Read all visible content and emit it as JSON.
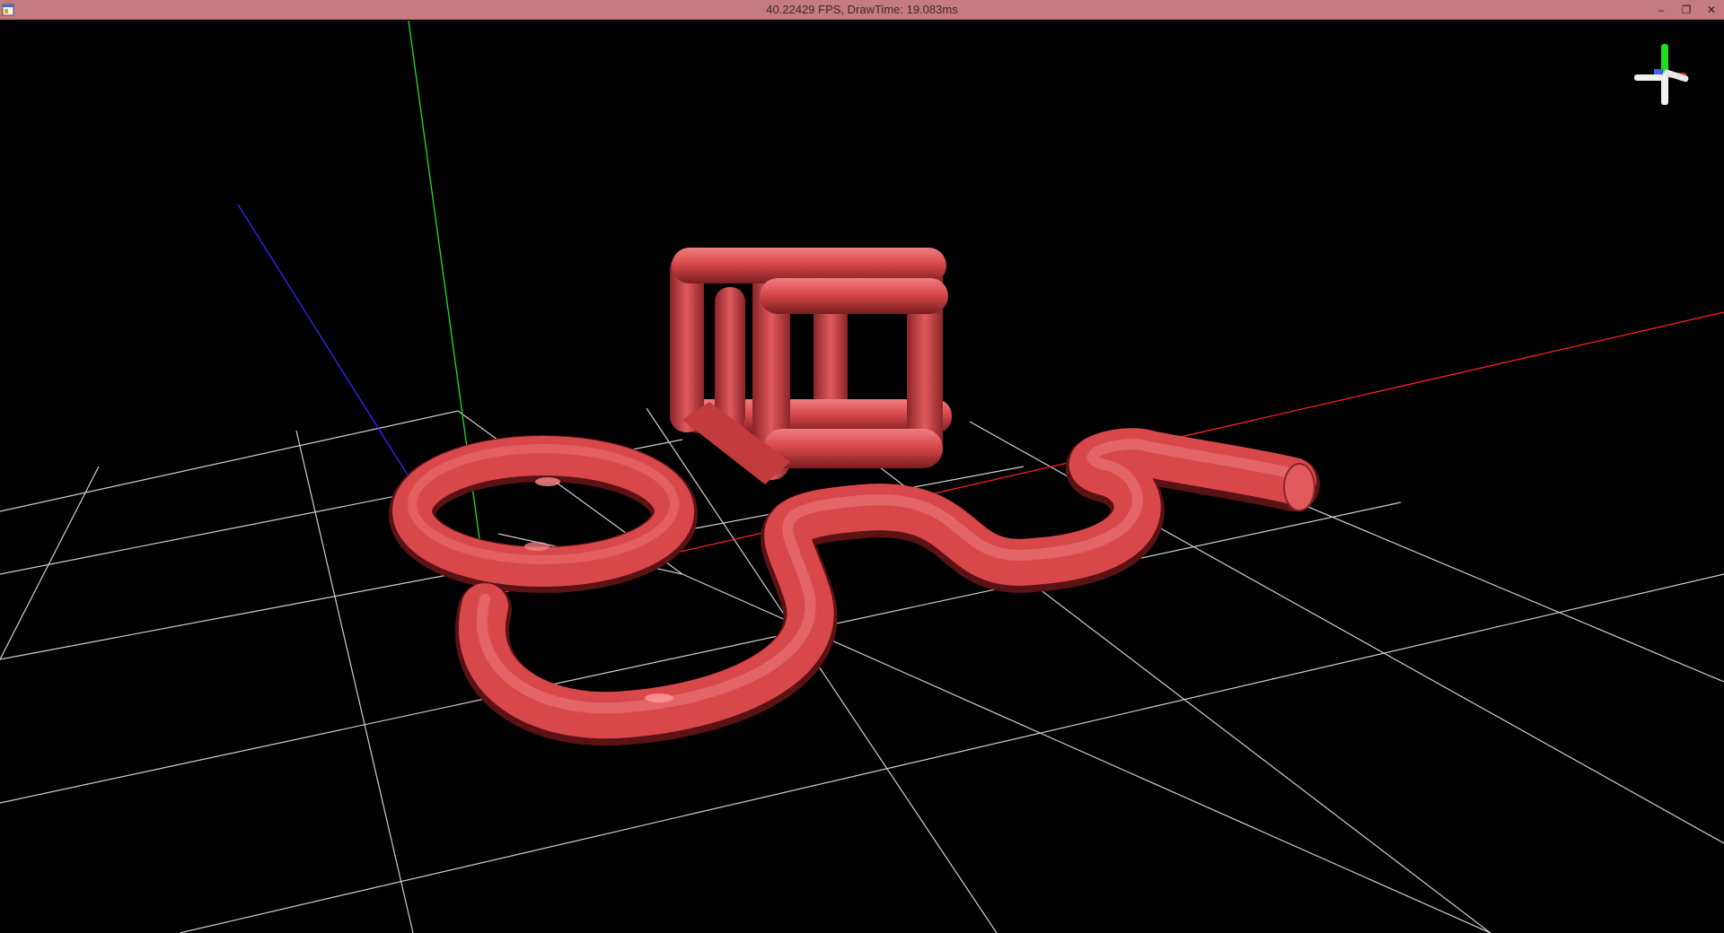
{
  "window": {
    "title": "40.22429 FPS, DrawTime: 19.083ms",
    "buttons": {
      "minimize": "–",
      "restore": "❐",
      "close": "✕"
    }
  },
  "scene": {
    "background": "#000000",
    "grid_color": "#e6e6e6",
    "axis_colors": {
      "x": "#ff2020",
      "y": "#20e020",
      "z": "#2a2aff"
    },
    "object_color": "#d8484b",
    "objects": [
      "wireframe-cube-tubes",
      "torus-ring",
      "curved-tube"
    ],
    "view_cube_icon": "axis-gizmo-icon"
  }
}
